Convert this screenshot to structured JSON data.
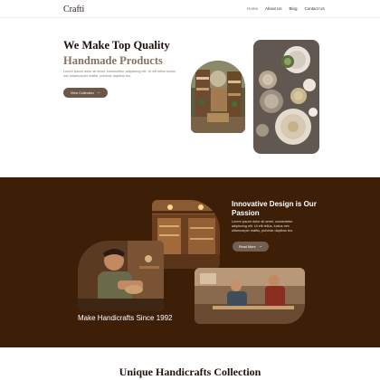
{
  "header": {
    "logo": "Crafti",
    "nav": [
      "Home",
      "About Us",
      "Blog",
      "Contact Us"
    ]
  },
  "hero": {
    "title": "We Make Top Quality",
    "subtitle": "Handmade Products",
    "description": "Lorem ipsum dolor sit amet, consectetur adipiscing elit. Ut elit tellus luctus nec ullamcorper mattis, pulvinar dapibus leo.",
    "button": "View Collection"
  },
  "innovation": {
    "title": "Innovative Design is Our Passion",
    "description": "Lorem ipsum dolor sit amet, consectetur adipiscing elit. Ut elit tellus, luctus nec ullamcorper mattis, pulvinar dapibus leo.",
    "button": "Read More",
    "since": "Make Handicrafts Since 1992"
  },
  "collection": {
    "title": "Unique Handicrafts Collection"
  },
  "colors": {
    "dark_band": "#3d1f08",
    "button": "#6b5848",
    "accent_text": "#86725d"
  },
  "icons": {
    "button_arrow": "arrow-right-icon"
  }
}
